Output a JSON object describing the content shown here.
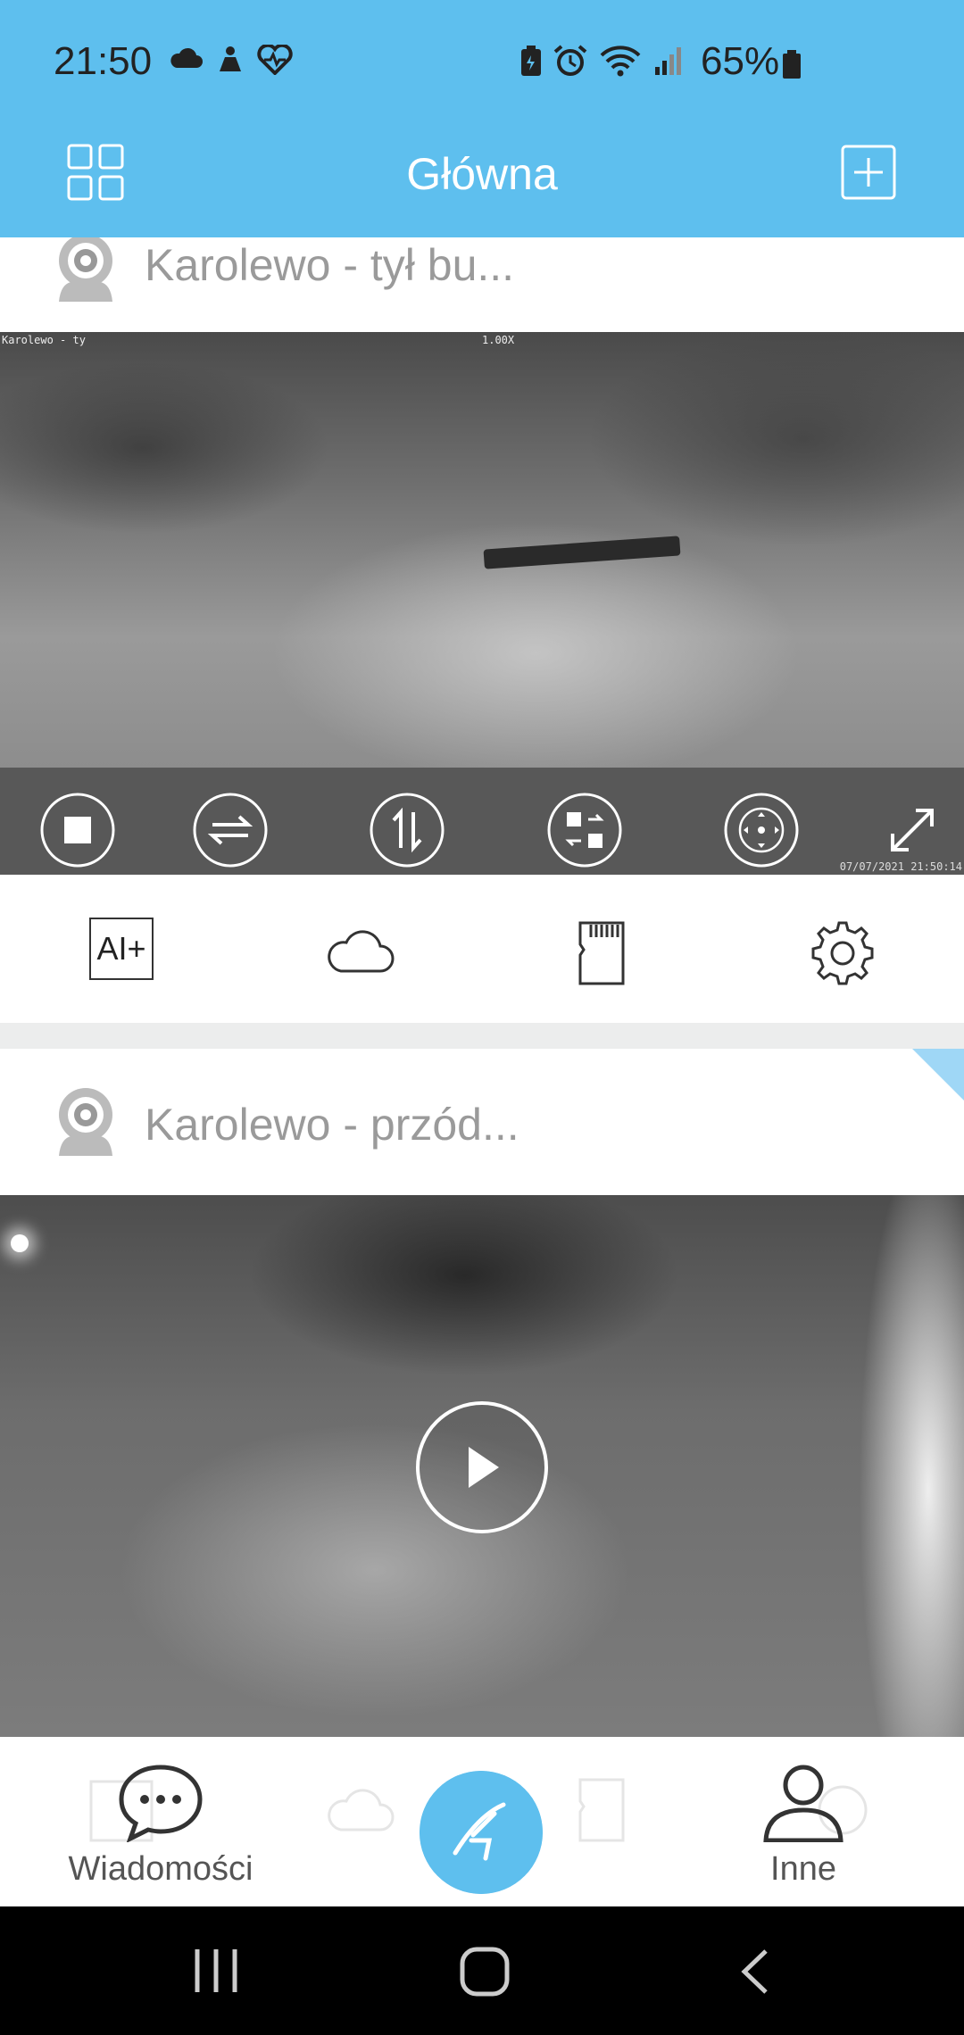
{
  "status_bar": {
    "time": "21:50",
    "battery": "65%",
    "left_icons": [
      "cloud-icon",
      "app-notification-icon",
      "health-icon"
    ],
    "right_icons": [
      "battery-saver-icon",
      "alarm-icon",
      "wifi-icon",
      "signal-icon",
      "battery-icon"
    ]
  },
  "app_bar": {
    "title": "Główna",
    "left_icon": "grid-view-icon",
    "right_icon": "add-device-icon"
  },
  "cameras": [
    {
      "name": "Karolewo - tył bu...",
      "osd_name": "Karolewo - ty",
      "osd_zoom": "1.00X",
      "osd_time": "07/07/2021 21:50:14",
      "controls": [
        "stop-icon",
        "mirror-horizontal-icon",
        "flip-vertical-icon",
        "switch-stream-icon",
        "ptz-icon",
        "fullscreen-icon"
      ],
      "features": {
        "ai_label": "AI+",
        "icons": [
          "ai-plus-icon",
          "cloud-icon",
          "sd-card-icon",
          "settings-icon"
        ]
      }
    },
    {
      "name": "Karolewo - przód...",
      "play_icon": "play-icon"
    }
  ],
  "bottom_nav": {
    "messages_label": "Wiadomości",
    "others_label": "Inne",
    "center_icon": "app-logo-icon"
  },
  "system_nav": [
    "recents-icon",
    "home-icon",
    "back-icon"
  ],
  "colors": {
    "accent": "#5ebfee",
    "divider": "#eceded",
    "header_text": "#ffffff",
    "camera_name": "#9a9a9a"
  }
}
